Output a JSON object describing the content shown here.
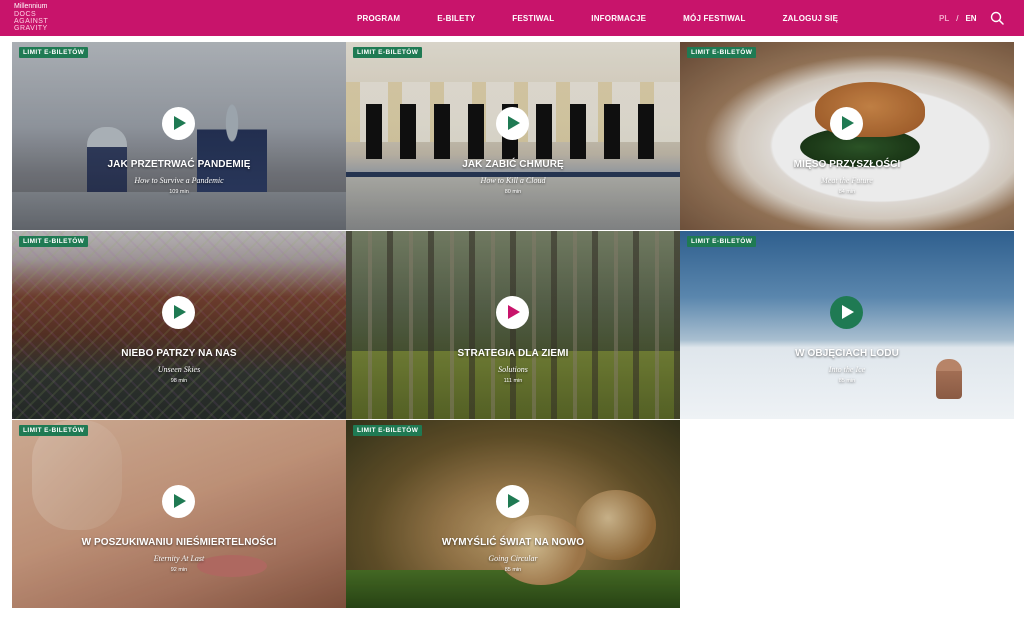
{
  "header": {
    "logo_line1": "Millennium",
    "logo_line2": "DOCS",
    "logo_line3": "AGAINST",
    "logo_line4": "GRAVITY",
    "nav": [
      "PROGRAM",
      "E-BILETY",
      "FESTIWAL",
      "INFORMACJE",
      "MÓJ FESTIWAL",
      "ZALOGUJ SIĘ"
    ],
    "lang_pl": "PL",
    "lang_sep": "/",
    "lang_en": "EN",
    "search_icon": "search-icon"
  },
  "colors": {
    "brand": "#c8146b",
    "badge": "#1f7a53"
  },
  "films": [
    {
      "badge": "LIMIT E-BILETÓW",
      "title": "JAK PRZETRWAĆ PANDEMIĘ",
      "subtitle": "How to Survive a Pandemic",
      "duration": "109 min"
    },
    {
      "badge": "LIMIT E-BILETÓW",
      "title": "JAK ZABIĆ CHMURĘ",
      "subtitle": "How to Kill a Cloud",
      "duration": "80 min"
    },
    {
      "badge": "LIMIT E-BILETÓW",
      "title": "MIĘSO PRZYSZŁOŚCI",
      "subtitle": "Meat the Future",
      "duration": "84 min"
    },
    {
      "badge": "LIMIT E-BILETÓW",
      "title": "NIEBO PATRZY NA NAS",
      "subtitle": "Unseen Skies",
      "duration": "98 min"
    },
    {
      "badge": "",
      "title": "STRATEGIA DLA ZIEMI",
      "subtitle": "Solutions",
      "duration": "111 min"
    },
    {
      "badge": "LIMIT E-BILETÓW",
      "title": "W OBJĘCIACH LODU",
      "subtitle": "Into the Ice",
      "duration": "85 min"
    },
    {
      "badge": "LIMIT E-BILETÓW",
      "title": "W POSZUKIWANIU NIEŚMIERTELNOŚCI",
      "subtitle": "Eternity At Last",
      "duration": "92 min"
    },
    {
      "badge": "LIMIT E-BILETÓW",
      "title": "WYMYŚLIĆ ŚWIAT NA NOWO",
      "subtitle": "Going Circular",
      "duration": "85 min"
    }
  ]
}
